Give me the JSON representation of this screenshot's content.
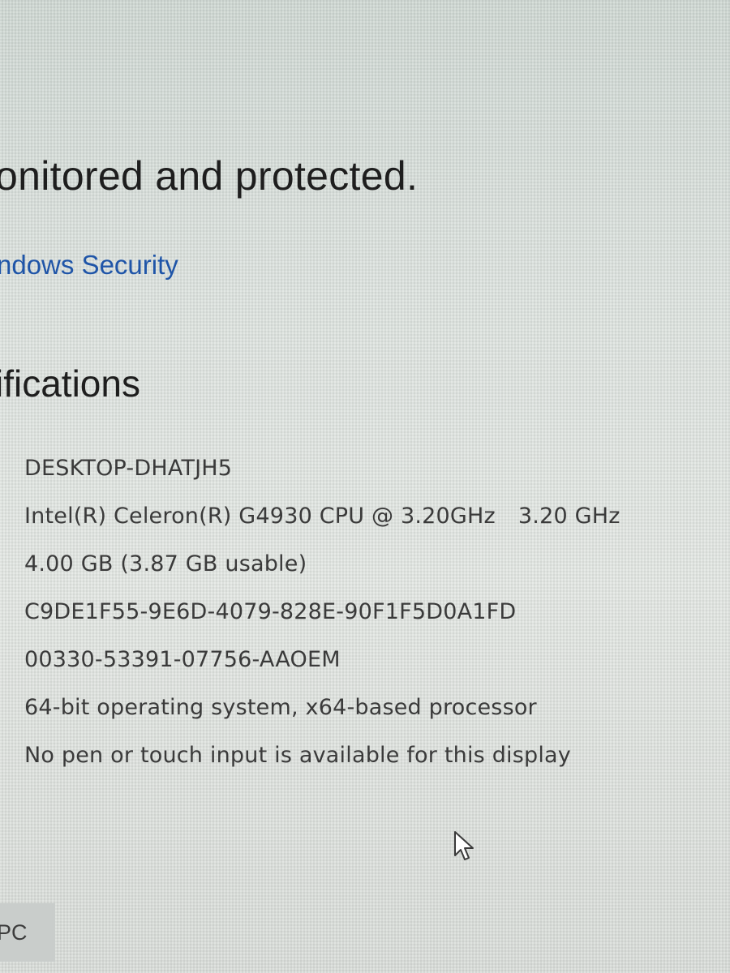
{
  "status": {
    "title": "onitored and protected.",
    "link_label": "ndows Security"
  },
  "specifications": {
    "heading": "ifications",
    "rows": [
      {
        "value": "DESKTOP-DHATJH5"
      },
      {
        "value": "Intel(R) Celeron(R) G4930 CPU @ 3.20GHz",
        "extra": "3.20 GHz"
      },
      {
        "value": "4.00 GB (3.87 GB usable)"
      },
      {
        "value": "C9DE1F55-9E6D-4079-828E-90F1F5D0A1FD"
      },
      {
        "value": "00330-53391-07756-AAOEM"
      },
      {
        "value": "64-bit operating system, x64-based processor"
      },
      {
        "value": "No pen or touch input is available for this display"
      }
    ]
  },
  "bottom_tile": {
    "label": "PC"
  },
  "icons": {
    "cursor": "mouse-pointer-icon"
  },
  "colors": {
    "link": "#1f55a8",
    "text": "#1e1e1e",
    "spec_text": "#3a3a3a"
  }
}
